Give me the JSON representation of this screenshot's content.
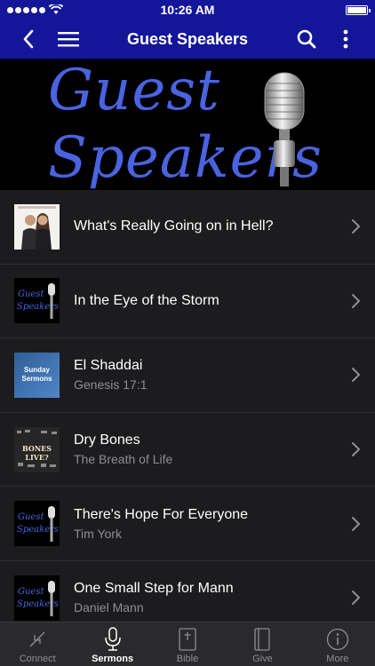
{
  "status": {
    "time": "10:26 AM"
  },
  "navbar": {
    "title": "Guest Speakers"
  },
  "banner": {
    "line1": "Guest",
    "line2": "Speakers"
  },
  "items": [
    {
      "title": "What's Really Going on in Hell?",
      "subtitle": "",
      "thumb": "couple-photo"
    },
    {
      "title": "In the Eye of the Storm",
      "subtitle": "",
      "thumb": "guest-speakers-art"
    },
    {
      "title": "El Shaddai",
      "subtitle": "Genesis 17:1",
      "thumb": "sunday-sermons-art",
      "thumb_text_1": "Sunday",
      "thumb_text_2": "Sermons"
    },
    {
      "title": "Dry Bones",
      "subtitle": "The Breath of Life",
      "thumb": "dry-bones-art",
      "thumb_text_1": "BONES LIVE?"
    },
    {
      "title": "There's Hope For Everyone",
      "subtitle": "Tim York",
      "thumb": "guest-speakers-art"
    },
    {
      "title": "One Small Step for Mann",
      "subtitle": "Daniel Mann",
      "thumb": "guest-speakers-art"
    }
  ],
  "thumb_guest": {
    "line1": "Guest",
    "line2": "Speakers"
  },
  "tabs": [
    {
      "label": "Connect",
      "icon": "connect-icon",
      "active": false
    },
    {
      "label": "Sermons",
      "icon": "microphone-icon",
      "active": true
    },
    {
      "label": "Bible",
      "icon": "bible-icon",
      "active": false
    },
    {
      "label": "Give",
      "icon": "give-icon",
      "active": false
    },
    {
      "label": "More",
      "icon": "info-icon",
      "active": false
    }
  ],
  "colors": {
    "nav": "#14169a",
    "list_bg": "#1c1c1e",
    "banner_text": "#4a63e0"
  }
}
